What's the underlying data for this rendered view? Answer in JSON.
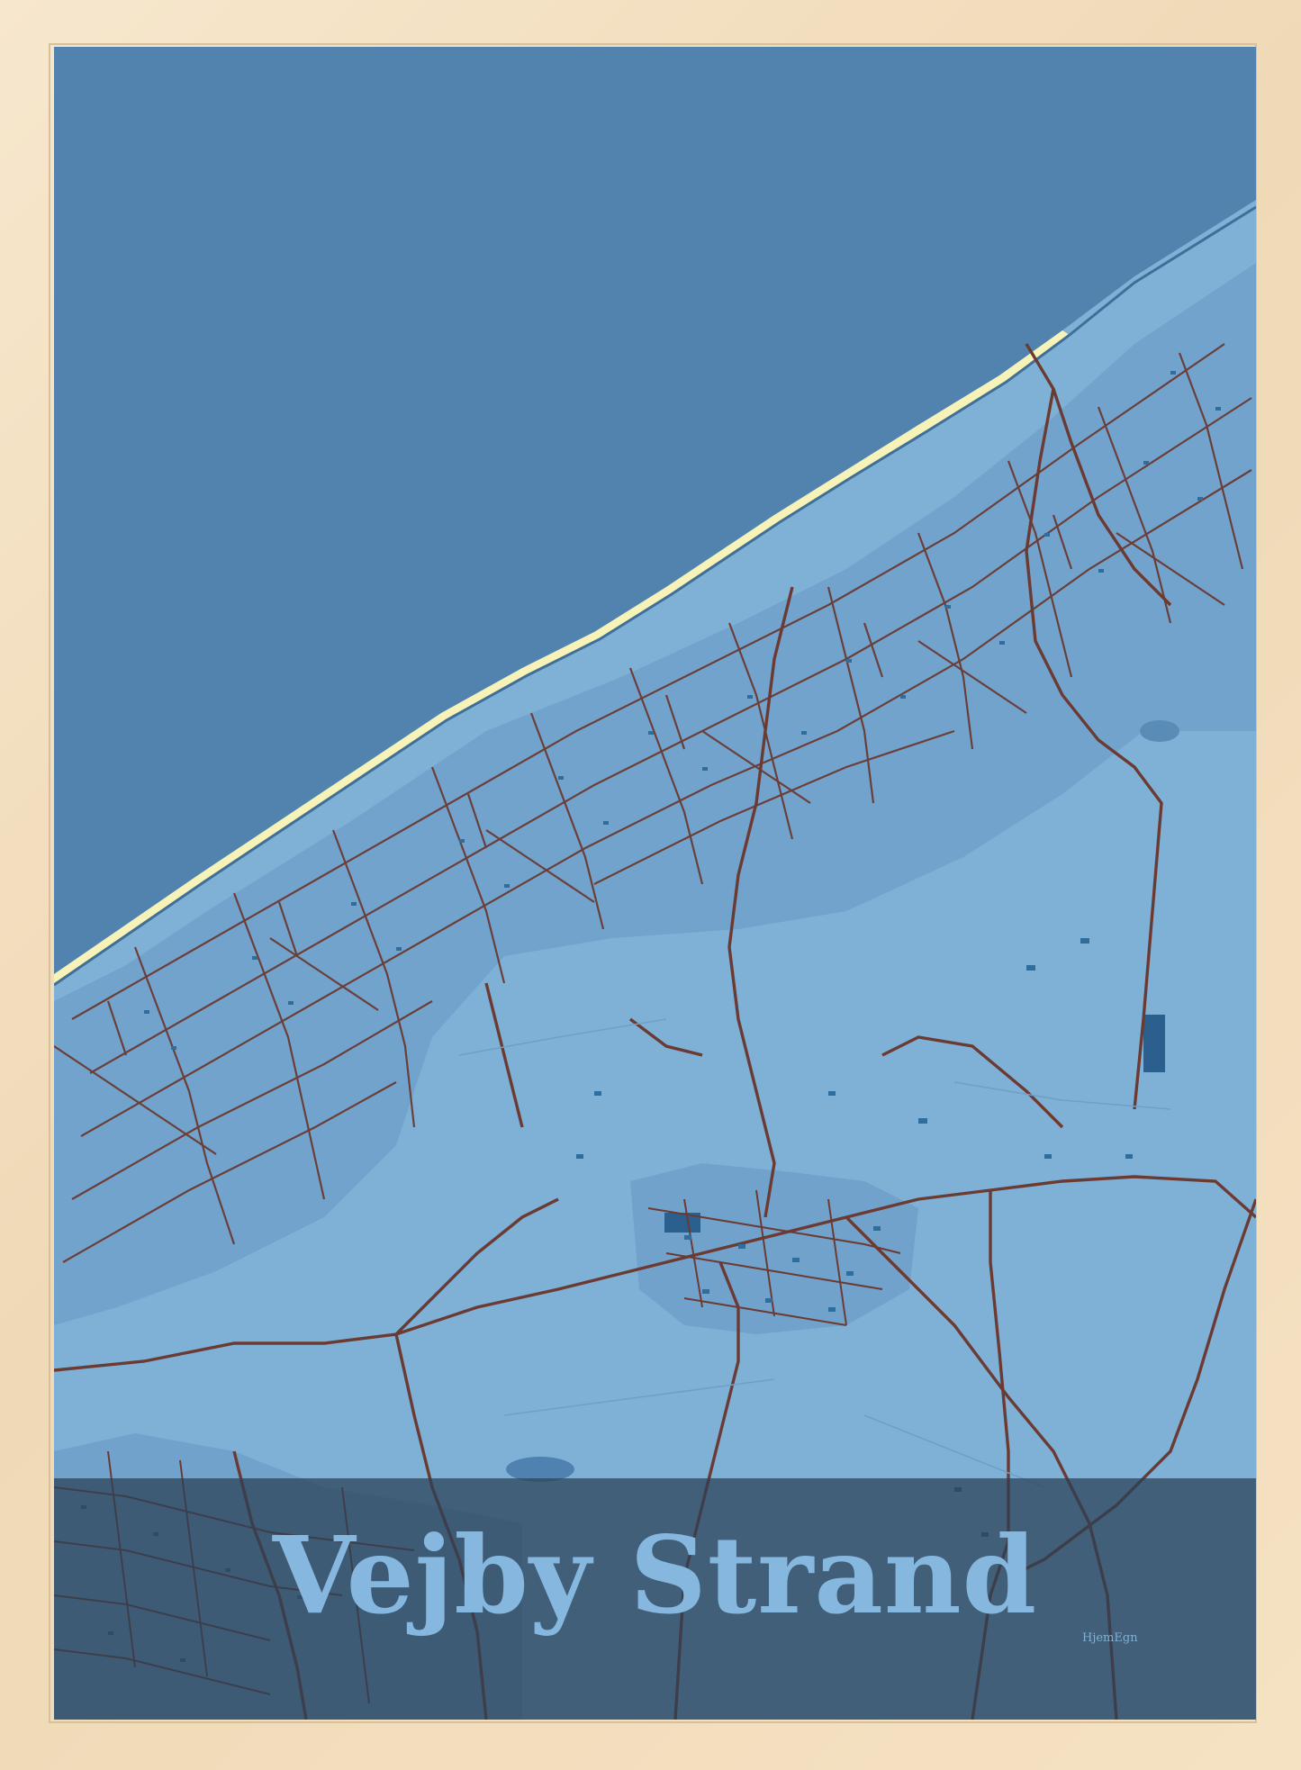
{
  "poster": {
    "title": "Vejby Strand",
    "brand": "HjemEgn"
  },
  "colors": {
    "frame": "#f4e3c8",
    "sea": "#5283ae",
    "land": "#7fb0d6",
    "urban": "#6e9fc8",
    "beach": "#f7f2b8",
    "road": "#6b3a32",
    "building": "#2f6d9c",
    "title_band": "#2b4054",
    "title_text": "#86b8df"
  }
}
